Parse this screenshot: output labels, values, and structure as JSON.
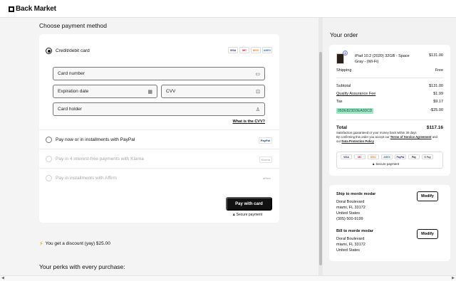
{
  "header": {
    "logo_text": "Back Market"
  },
  "payment": {
    "title": "Choose payment method",
    "methods": [
      {
        "label": "Credit/debit card",
        "selected": true,
        "disabled": false
      },
      {
        "label": "Pay now or in installments with PayPal",
        "selected": false,
        "disabled": false,
        "logo": "PayPal"
      },
      {
        "label": "Pay in 4 interest-free payments with Klarna",
        "selected": false,
        "disabled": true,
        "logo": "Klarna"
      },
      {
        "label": "Pay in installments with Affirm",
        "selected": false,
        "disabled": true,
        "logo": "affirm"
      }
    ],
    "card_brands": [
      "VISA",
      "MC",
      "DISC",
      "AMEX"
    ],
    "fields": {
      "card_number": "Card number",
      "expiration": "Expiration date",
      "cvv": "CVV",
      "card_holder": "Card holder"
    },
    "cvv_link": "What is the CVV?",
    "pay_button": "Pay with card",
    "secure_payment": "Secure payment"
  },
  "discount": {
    "text": "You get a discount (yay) $25.00",
    "icon": "lightning-icon"
  },
  "perks": {
    "title": "Your perks with every purchase:"
  },
  "order": {
    "title": "Your order",
    "item": {
      "name": "iPad 10.2 (2020) 32GB - Space Gray - (Wi-Fi)",
      "price": "$131.00",
      "qty_badge": "1"
    },
    "shipping_label": "Shipping",
    "shipping_value": "Free",
    "subtotal_label": "Subtotal",
    "subtotal_value": "$131.00",
    "qa_fee_label": "Quality Assurance Fee",
    "qa_fee_value": "$1.99",
    "tax_label": "Tax",
    "tax_value": "$9.17",
    "promo_code": "05DE823DDEA0DCD",
    "promo_value": "-$25.00",
    "total_label": "Total",
    "total_value": "$117.16",
    "fine_print_1": "Satisfaction guaranteed or your money back within 30 days",
    "fine_print_2": "By confirming this order you accept our",
    "terms_link": "Terms of Service Agreement",
    "fine_print_3": "and our",
    "privacy_link": "Data Protection Policy",
    "pay_brands": [
      "VISA",
      "MC",
      "DISC",
      "AMEX",
      "PayPal",
      "Pay",
      "G Pay"
    ],
    "secure_payment": "Secure payment"
  },
  "shipping_address": {
    "title": "Ship to morde modar",
    "lines": [
      "Doral Boulevard",
      "miami, FL 33172",
      "United States",
      "(305) 500-9199"
    ],
    "modify": "Modify"
  },
  "billing_address": {
    "title": "Bill to morde modar",
    "lines": [
      "Doral Boulevard",
      "miami, FL 33172",
      "United States"
    ],
    "modify": "Modify"
  }
}
